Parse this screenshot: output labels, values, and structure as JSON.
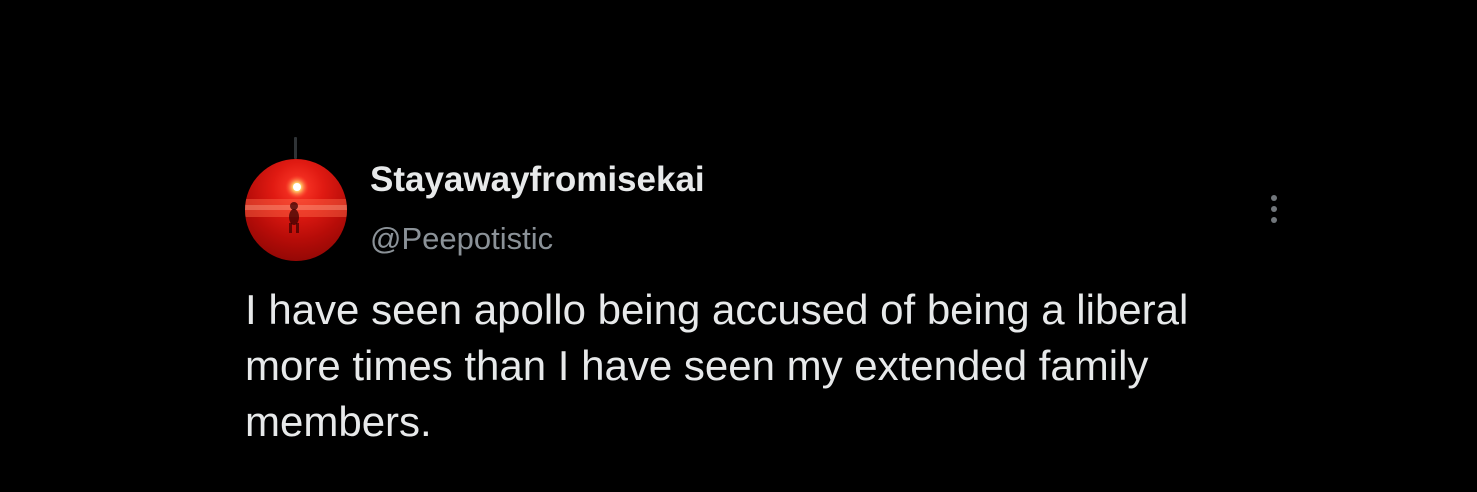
{
  "tweet": {
    "display_name": "Stayawayfromisekai",
    "handle": "@Peepotistic",
    "text": "I have seen apollo being accused of being a liberal\nmore times than I have seen my extended family\nmembers.",
    "more_icon": "more-vertical-icon"
  },
  "colors": {
    "background": "#000000",
    "primary_text": "#e7e9ea",
    "secondary_text": "#8b9298",
    "avatar_accent": "#e01a12"
  }
}
